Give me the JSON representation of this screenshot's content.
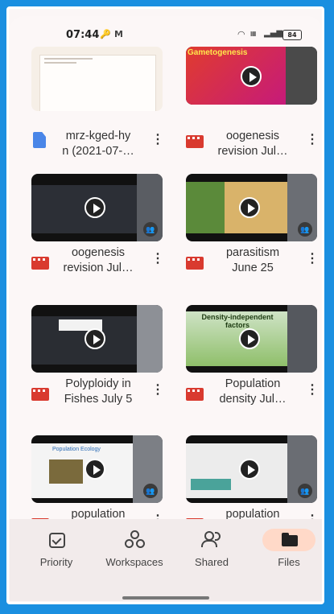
{
  "status_bar": {
    "time": "07:44",
    "battery": "84",
    "icons": [
      "key-icon",
      "gmail-icon",
      "wifi-icon",
      "volte-icon",
      "signal-icon",
      "battery-icon"
    ]
  },
  "colors": {
    "frame_blue": "#1a8fe0",
    "video_red": "#d93a2f",
    "doc_blue": "#4a86e8",
    "active_tab_bg": "#ffd9c8"
  },
  "files": [
    {
      "name": "mrz-kged-hy\nn (2021-07-…",
      "type": "document"
    },
    {
      "name": "oogenesis\nrevision Jul…",
      "type": "video",
      "thumb_text": "Gametogenesis"
    },
    {
      "name": "oogenesis\nrevision Jul…",
      "type": "video"
    },
    {
      "name": "parasitism\nJune 25",
      "type": "video"
    },
    {
      "name": "Polyploidy in\nFishes July 5",
      "type": "video"
    },
    {
      "name": "Population\ndensity Jul…",
      "type": "video",
      "thumb_text": "Density-independent factors"
    },
    {
      "name": "population\necology Ju…",
      "type": "video",
      "thumb_text": "Population Ecology"
    },
    {
      "name": "population\necology re…",
      "type": "video"
    }
  ],
  "nav": {
    "items": [
      {
        "label": "Priority",
        "icon": "priority-icon",
        "active": false
      },
      {
        "label": "Workspaces",
        "icon": "workspaces-icon",
        "active": false
      },
      {
        "label": "Shared",
        "icon": "shared-icon",
        "active": false
      },
      {
        "label": "Files",
        "icon": "folder-icon",
        "active": true
      }
    ]
  }
}
